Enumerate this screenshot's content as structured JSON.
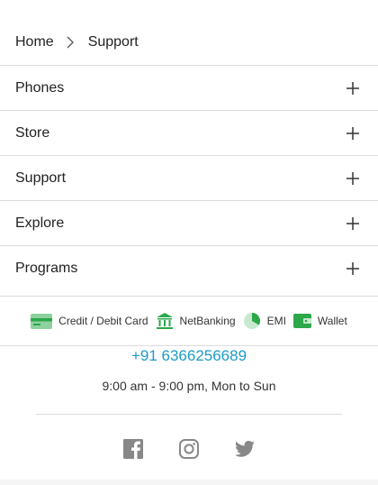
{
  "breadcrumb": {
    "home": "Home",
    "current": "Support"
  },
  "accordion": [
    {
      "label": "Phones"
    },
    {
      "label": "Store"
    },
    {
      "label": "Support"
    },
    {
      "label": "Explore"
    },
    {
      "label": "Programs"
    }
  ],
  "payments": {
    "card": "Credit / Debit Card",
    "netbanking": "NetBanking",
    "emi": "EMI",
    "wallet": "Wallet"
  },
  "contact": {
    "phone": "+91 6366256689",
    "hours": "9:00 am - 9:00 pm, Mon to Sun"
  },
  "social": [
    "facebook-icon",
    "instagram-icon",
    "twitter-icon"
  ],
  "colors": {
    "accent": "#1d9bc4",
    "payment_green": "#2aa84a",
    "divider": "#dcdcdc"
  }
}
